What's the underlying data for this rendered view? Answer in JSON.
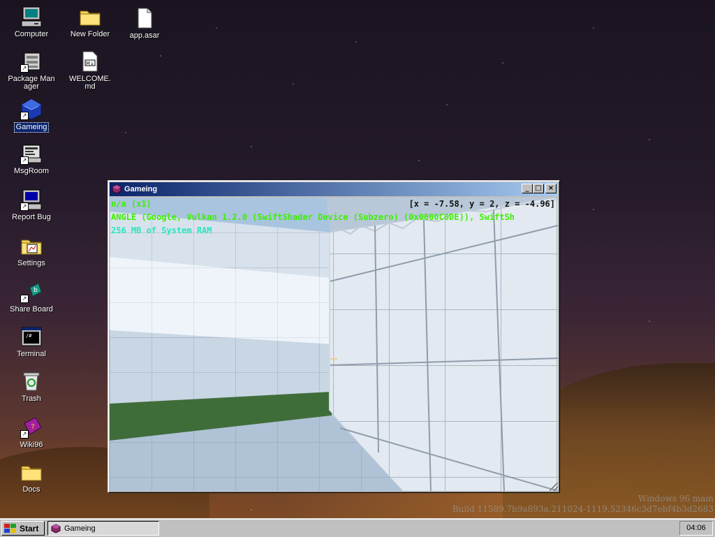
{
  "desktop": {
    "icons": [
      {
        "label": "Computer",
        "icon": "computer-icon"
      },
      {
        "label": "New Folder",
        "icon": "folder-icon"
      },
      {
        "label": "app.asar",
        "icon": "file-icon"
      },
      {
        "label": "Package Manager",
        "icon": "package-manager-icon"
      },
      {
        "label": "WELCOME.md",
        "icon": "markdown-file-icon"
      },
      {
        "label": "Gameing",
        "icon": "gameing-icon",
        "selected": true
      },
      {
        "label": "MsgRoom",
        "icon": "msgroom-icon"
      },
      {
        "label": "Report Bug",
        "icon": "report-bug-icon"
      },
      {
        "label": "Settings",
        "icon": "settings-icon"
      },
      {
        "label": "Share Board",
        "icon": "share-board-icon"
      },
      {
        "label": "Terminal",
        "icon": "terminal-icon"
      },
      {
        "label": "Trash",
        "icon": "trash-icon"
      },
      {
        "label": "Wiki96",
        "icon": "wiki96-icon"
      },
      {
        "label": "Docs",
        "icon": "folder-icon"
      }
    ],
    "watermark": {
      "line1": "Windows 96 main",
      "line2": "Build 11589.7b9a893a.211024-1119.52346c3d7ebf4b3d2683"
    }
  },
  "window": {
    "title": "Gameing",
    "controls": {
      "minimize": "_",
      "maximize": "□",
      "close": "×"
    },
    "hud": {
      "name": "n/a (x1)",
      "coords": "[x = -7.58, y = 2, z = -4.96]",
      "renderer": "ANGLE (Google, Vulkan 1.2.0 (SwiftShader Device (Subzero) (0x0000C0DE)), SwiftSh",
      "memory": "256 MB of System RAM"
    }
  },
  "taskbar": {
    "start_label": "Start",
    "task_label": "Gameing",
    "clock": "04:06"
  },
  "colors": {
    "titlebar_start": "#0a246a",
    "titlebar_end": "#a6caf0",
    "hud_green": "#3cf000",
    "hud_cyan": "#28e6c0",
    "floor_green": "#3f6d3a"
  }
}
